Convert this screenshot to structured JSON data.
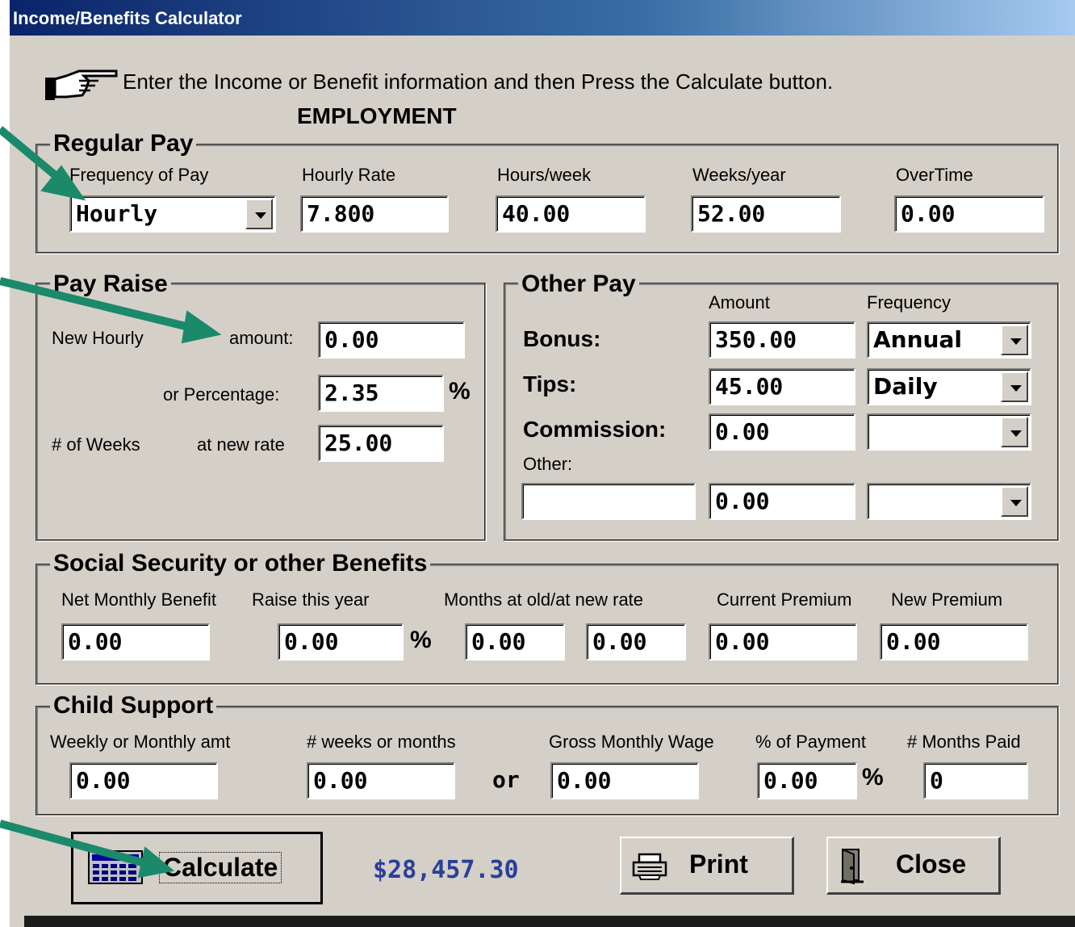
{
  "window": {
    "title": "Income/Benefits Calculator"
  },
  "instruction": {
    "text": "Enter the Income or Benefit information and then Press the Calculate button.",
    "icon": "pointing-hand-icon"
  },
  "section_heading": "EMPLOYMENT",
  "regular_pay": {
    "legend": "Regular Pay",
    "labels": {
      "frequency": "Frequency of Pay",
      "hourly_rate": "Hourly Rate",
      "hours_week": "Hours/week",
      "weeks_year": "Weeks/year",
      "overtime": "OverTime"
    },
    "values": {
      "frequency": "Hourly",
      "hourly_rate": "7.800",
      "hours_week": "40.00",
      "weeks_year": "52.00",
      "overtime": "0.00"
    }
  },
  "pay_raise": {
    "legend": "Pay Raise",
    "labels": {
      "new_hourly": "New Hourly",
      "amount": "amount:",
      "percentage": "or Percentage:",
      "pct_sign": "%",
      "weeks": "# of Weeks",
      "at_new_rate": "at new rate"
    },
    "values": {
      "amount": "0.00",
      "percentage": "2.35",
      "weeks": "25.00"
    }
  },
  "other_pay": {
    "legend": "Other Pay",
    "labels": {
      "amount": "Amount",
      "frequency": "Frequency",
      "bonus": "Bonus:",
      "tips": "Tips:",
      "commission": "Commission:",
      "other": "Other:"
    },
    "values": {
      "bonus_amount": "350.00",
      "bonus_frequency": "Annual",
      "tips_amount": "45.00",
      "tips_frequency": "Daily",
      "commission_amount": "0.00",
      "commission_frequency": "",
      "other_name": "",
      "other_amount": "0.00",
      "other_frequency": ""
    }
  },
  "social_security": {
    "legend": "Social Security or other Benefits",
    "labels": {
      "net_monthly": "Net Monthly Benefit",
      "raise": "Raise this year",
      "pct_sign": "%",
      "months": "Months at old/at new rate",
      "current_premium": "Current Premium",
      "new_premium": "New Premium"
    },
    "values": {
      "net_monthly": "0.00",
      "raise": "0.00",
      "months_old": "0.00",
      "months_new": "0.00",
      "current_premium": "0.00",
      "new_premium": "0.00"
    }
  },
  "child_support": {
    "legend": "Child Support",
    "labels": {
      "amt": "Weekly or Monthly amt",
      "weeks": "# weeks or months",
      "or": "or",
      "gross": "Gross Monthly Wage",
      "pct_payment": "% of Payment",
      "pct_sign": "%",
      "months_paid": "# Months Paid"
    },
    "values": {
      "amt": "0.00",
      "weeks": "0.00",
      "gross": "0.00",
      "pct_payment": "0.00",
      "months_paid": "0"
    }
  },
  "buttons": {
    "calculate": "Calculate",
    "print": "Print",
    "close": "Close"
  },
  "result": "$28,457.30",
  "colors": {
    "window_bg": "#d4d0c8",
    "title_bar": "#0a246a",
    "arrow": "#1a8a6a",
    "result_text": "#2a3f9a"
  }
}
